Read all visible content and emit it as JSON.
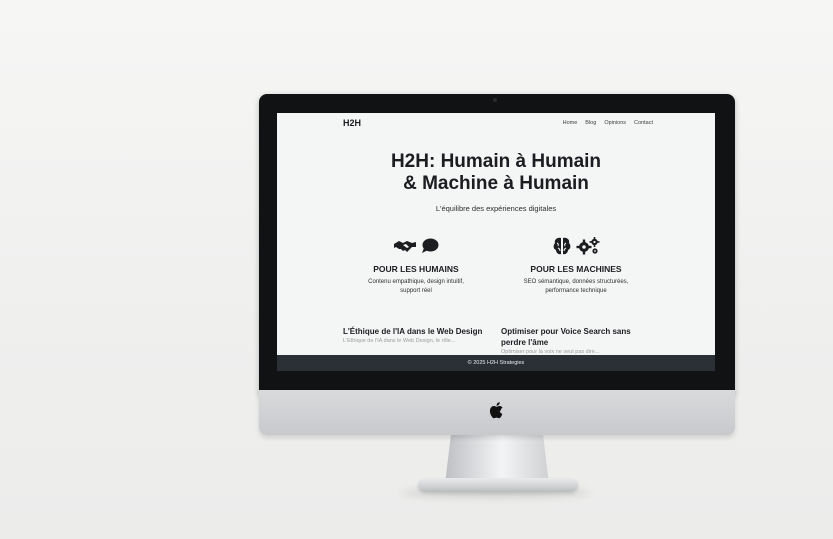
{
  "site": {
    "brand": "H2H",
    "nav": [
      "Home",
      "Blog",
      "Opinions",
      "Contact"
    ],
    "hero_title_line1": "H2H: Humain à Humain",
    "hero_title_line2": "& Machine à Humain",
    "hero_subtitle": "L'équilibre des expériences digitales",
    "features": [
      {
        "title": "POUR LES HUMAINS",
        "desc_line1": "Contenu empathique, design intuitif,",
        "desc_line2": "support réel",
        "icons": [
          "handshake-icon",
          "speech-bubble-icon"
        ]
      },
      {
        "title": "POUR LES MACHINES",
        "desc_line1": "SEO sémantique, données structurées,",
        "desc_line2": "performance technique",
        "icons": [
          "brain-icon",
          "gears-icon"
        ]
      }
    ],
    "posts": [
      {
        "title": "L'Éthique de l'IA dans le Web Design",
        "excerpt": "L'Éthique de l'IA dans le Web Design, le rôle..."
      },
      {
        "title": "Optimiser pour Voice Search sans perdre l'âme",
        "excerpt": "Optimiser pour la voix ne veut pas dire..."
      }
    ],
    "footer": "© 2025 H2H Strategies"
  },
  "colors": {
    "text": "#1b1d20",
    "footer_bg": "#2b3036",
    "screen_bg": "#f4f5f5",
    "bezel": "#111213"
  },
  "device": {
    "chin_icon": "apple-logo-icon"
  }
}
